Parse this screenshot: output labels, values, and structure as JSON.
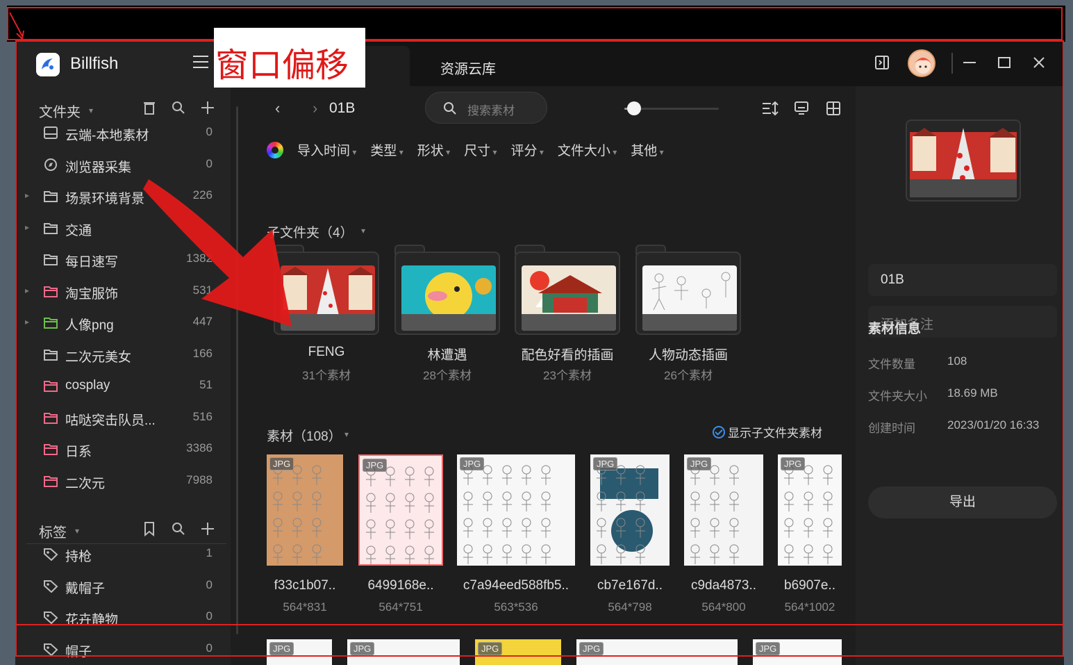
{
  "annotation": {
    "caption": "窗口偏移"
  },
  "app": {
    "name": "Billfish",
    "tab": "资源云库"
  },
  "sidebar": {
    "folders_title": "文件夹",
    "folders": [
      {
        "name": "云端-本地素材",
        "count": "0",
        "icon": "cloud-storage-icon",
        "expandable": false,
        "color": "#bdbdbd"
      },
      {
        "name": "浏览器采集",
        "count": "0",
        "icon": "compass-icon",
        "expandable": false,
        "color": "#bdbdbd"
      },
      {
        "name": "场景环境背景",
        "count": "226",
        "icon": "folder-icon",
        "expandable": true,
        "color": "#bdbdbd"
      },
      {
        "name": "交通",
        "count": "",
        "icon": "folder-icon",
        "expandable": true,
        "color": "#bdbdbd"
      },
      {
        "name": "每日速写",
        "count": "1382",
        "icon": "folder-icon",
        "expandable": false,
        "color": "#bdbdbd"
      },
      {
        "name": "淘宝服饰",
        "count": "531",
        "icon": "folder-icon",
        "expandable": true,
        "color": "#f06a8a"
      },
      {
        "name": "人像png",
        "count": "447",
        "icon": "folder-icon",
        "expandable": true,
        "color": "#6cc04a"
      },
      {
        "name": "二次元美女",
        "count": "166",
        "icon": "folder-icon",
        "expandable": false,
        "color": "#bdbdbd"
      },
      {
        "name": "cosplay",
        "count": "51",
        "icon": "folder-icon",
        "expandable": false,
        "color": "#f06a8a"
      },
      {
        "name": "咕哒突击队员...",
        "count": "516",
        "icon": "folder-icon",
        "expandable": false,
        "color": "#f06a8a"
      },
      {
        "name": "日系",
        "count": "3386",
        "icon": "folder-icon",
        "expandable": false,
        "color": "#f06a8a"
      },
      {
        "name": "二次元",
        "count": "7988",
        "icon": "folder-icon",
        "expandable": false,
        "color": "#f06a8a"
      }
    ],
    "tags_title": "标签",
    "tags": [
      {
        "name": "持枪",
        "count": "1"
      },
      {
        "name": "戴帽子",
        "count": "0"
      },
      {
        "name": "花卉静物",
        "count": "0"
      },
      {
        "name": "帽子",
        "count": "0"
      }
    ]
  },
  "toolbar": {
    "crumb": "01B",
    "search_placeholder": "搜索素材",
    "zoom": 0.1
  },
  "filters": [
    "导入时间",
    "类型",
    "形状",
    "尺寸",
    "评分",
    "文件大小",
    "其他"
  ],
  "subfolders": {
    "title": "子文件夹（4）",
    "items": [
      {
        "name": "FENG",
        "count": "31个素材"
      },
      {
        "name": "林遭遇",
        "count": "28个素材"
      },
      {
        "name": "配色好看的插画",
        "count": "23个素材"
      },
      {
        "name": "人物动态插画",
        "count": "26个素材"
      }
    ]
  },
  "assets": {
    "title": "素材（108）",
    "show_sub": "显示子文件夹素材",
    "badge": "JPG",
    "items": [
      {
        "name": "f33c1b07..",
        "dims": "564*831"
      },
      {
        "name": "6499168e..",
        "dims": "564*751"
      },
      {
        "name": "c7a94eed588fb5..",
        "dims": "563*536"
      },
      {
        "name": "cb7e167d..",
        "dims": "564*798"
      },
      {
        "name": "c9da4873..",
        "dims": "564*800"
      },
      {
        "name": "b6907e..",
        "dims": "564*1002"
      }
    ]
  },
  "panel": {
    "folder_name": "01B",
    "note_placeholder": "添加备注",
    "info_title": "素材信息",
    "file_count_label": "文件数量",
    "file_count": "108",
    "size_label": "文件夹大小",
    "size": "18.69 MB",
    "created_label": "创建时间",
    "created": "2023/01/20 16:33",
    "export_label": "导出"
  },
  "colors": {
    "accent": "#3b8ee8",
    "annotation_red": "#e02020"
  }
}
